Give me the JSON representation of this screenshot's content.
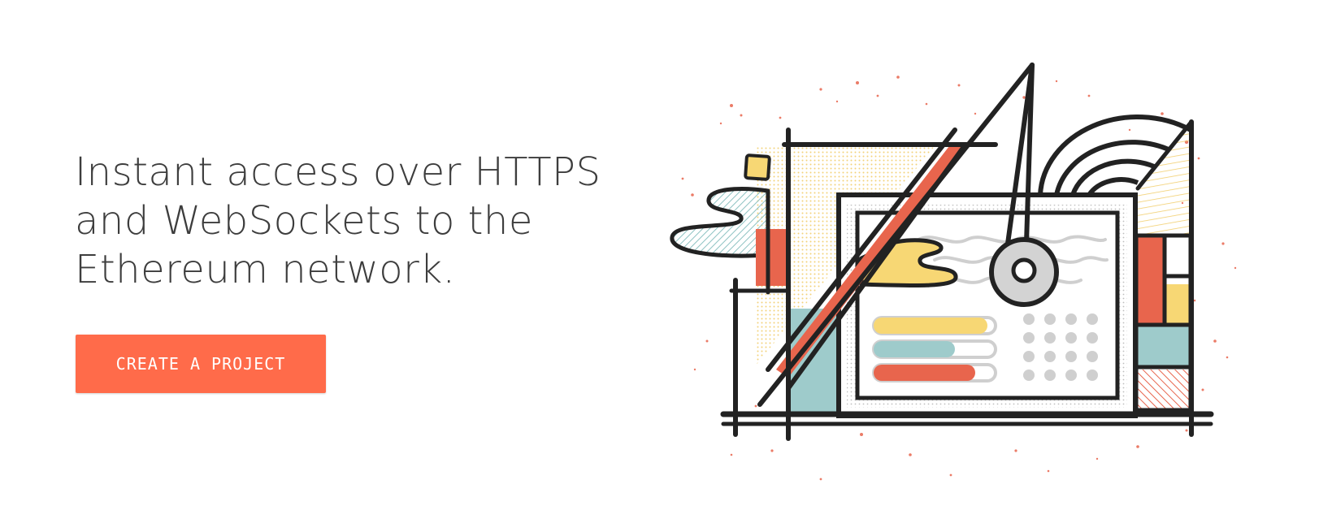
{
  "hero": {
    "headline_lines": [
      "Instant access over HTTPS",
      "and WebSockets to the",
      "Ethereum network."
    ],
    "cta_label": "CREATE A PROJECT"
  },
  "colors": {
    "accent": "#ff6b4a",
    "text": "#3d3d3d",
    "ink": "#222222",
    "yellow": "#f7d774",
    "teal": "#9ecbcb",
    "red": "#e8654d",
    "grey": "#c9c9c9",
    "background": "#ffffff"
  },
  "illustration": {
    "icon": "network-machine-illustration"
  }
}
